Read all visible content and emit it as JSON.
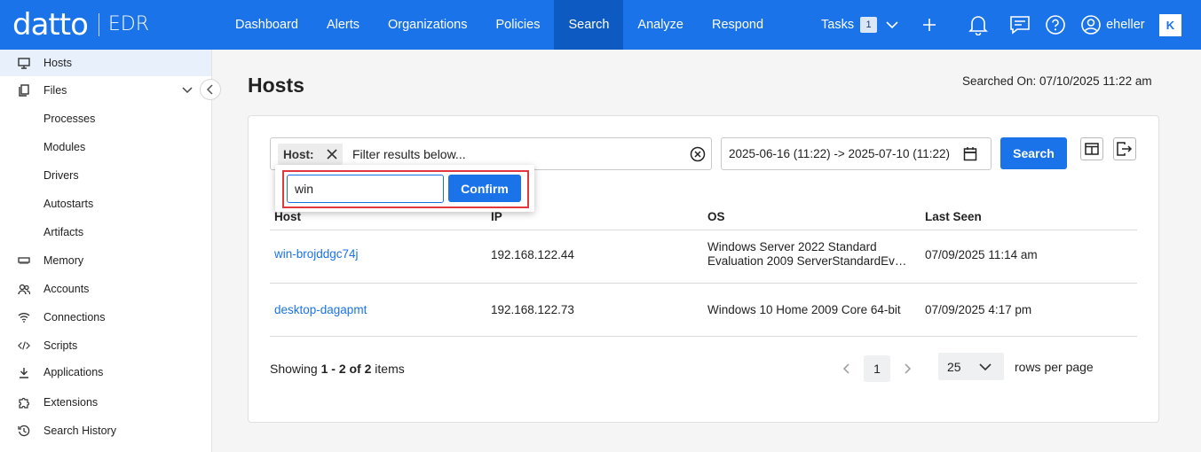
{
  "brand": {
    "name": "datto",
    "product": "EDR"
  },
  "nav": {
    "items": [
      {
        "label": "Dashboard"
      },
      {
        "label": "Alerts"
      },
      {
        "label": "Organizations"
      },
      {
        "label": "Policies"
      },
      {
        "label": "Search",
        "active": true
      },
      {
        "label": "Analyze"
      },
      {
        "label": "Respond"
      }
    ]
  },
  "topright": {
    "tasks_label": "Tasks",
    "tasks_count": "1",
    "username": "eheller",
    "k_logo": "K"
  },
  "sidebar": {
    "items": [
      {
        "label": "Hosts",
        "icon": "monitor-icon",
        "active": true
      },
      {
        "label": "Files",
        "icon": "files-icon",
        "expandable": true
      },
      {
        "label": "Processes",
        "sub": true
      },
      {
        "label": "Modules",
        "sub": true
      },
      {
        "label": "Drivers",
        "sub": true
      },
      {
        "label": "Autostarts",
        "sub": true
      },
      {
        "label": "Artifacts",
        "sub": true
      },
      {
        "label": "Memory",
        "icon": "memory-icon"
      },
      {
        "label": "Accounts",
        "icon": "accounts-icon"
      },
      {
        "label": "Connections",
        "icon": "wifi-icon"
      },
      {
        "label": "Scripts",
        "icon": "code-icon"
      },
      {
        "label": "Applications",
        "icon": "download-icon"
      },
      {
        "label": "Extensions",
        "icon": "puzzle-icon"
      },
      {
        "label": "Search History",
        "icon": "history-icon"
      }
    ]
  },
  "page": {
    "title": "Hosts",
    "searched_on": "Searched On: 07/10/2025 11:22 am"
  },
  "filter": {
    "chip_label": "Host:",
    "placeholder": "Filter results below...",
    "date_range": "2025-06-16 (11:22) -> 2025-07-10 (11:22)",
    "search_label": "Search"
  },
  "popup": {
    "value": "win",
    "confirm_label": "Confirm"
  },
  "table": {
    "columns": [
      "Host",
      "IP",
      "OS",
      "Last Seen"
    ],
    "rows": [
      {
        "host": "win-brojddgc74j",
        "ip": "192.168.122.44",
        "os_line1": "Windows Server 2022 Standard",
        "os_line2": "Evaluation 2009 ServerStandardEval...",
        "last_seen": "07/09/2025 11:14 am"
      },
      {
        "host": "desktop-dagapmt",
        "ip": "192.168.122.73",
        "os_line1": "Windows 10 Home 2009 Core 64-bit",
        "os_line2": "",
        "last_seen": "07/09/2025 4:17 pm"
      }
    ]
  },
  "footer": {
    "showing_prefix": "Showing ",
    "showing_range": "1 - 2 of 2",
    "showing_suffix": " items",
    "current_page": "1",
    "rows_per_page": "25",
    "rows_label": "rows per page"
  },
  "colors": {
    "accent": "#1a73e8",
    "nav_active": "#0d5bc2",
    "highlight": "#e0383e"
  }
}
